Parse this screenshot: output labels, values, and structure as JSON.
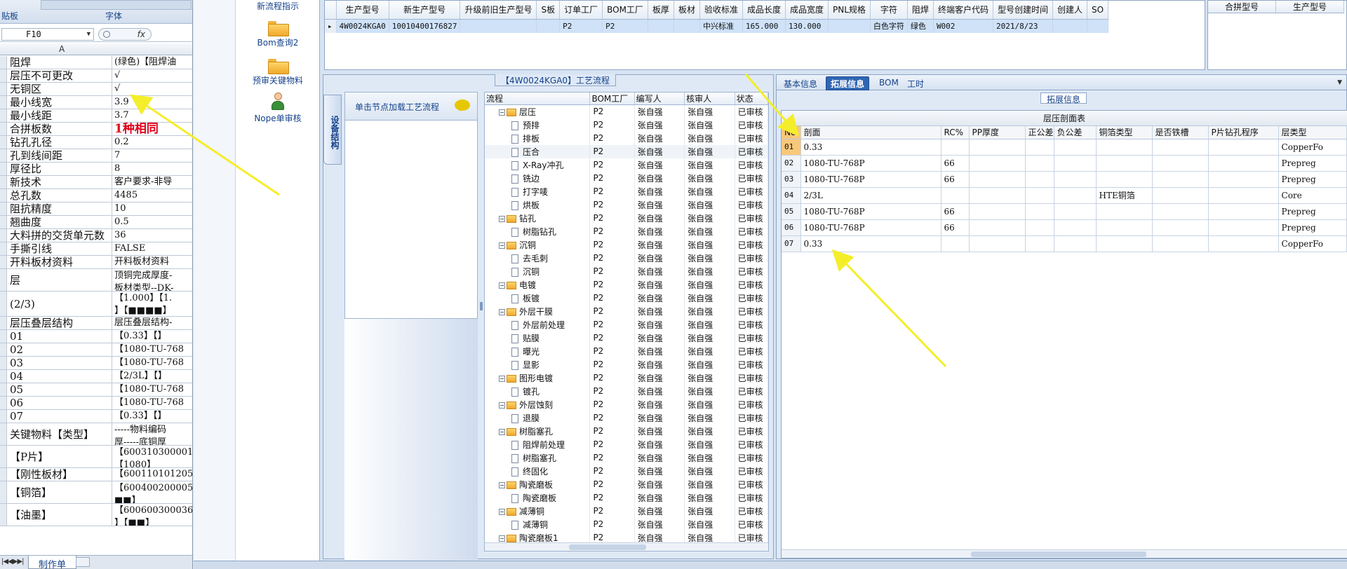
{
  "excel": {
    "ribbon_group_left": "贴板",
    "ribbon_group_font": "字体",
    "name_box": "F10",
    "fx": "fx",
    "col_header": "A",
    "rows": [
      {
        "a": "阻焊",
        "b": "(绿色)【阻焊油"
      },
      {
        "a": "层压不可更改",
        "b": "√"
      },
      {
        "a": "无铜区",
        "b": "√"
      },
      {
        "a": "最小线宽",
        "b": "3.9"
      },
      {
        "a": "最小线距",
        "b": "3.7"
      },
      {
        "a": "合拼板数",
        "b": "1种相同"
      },
      {
        "a": "钻孔孔径",
        "b": "0.2"
      },
      {
        "a": "孔到线间距",
        "b": "7"
      },
      {
        "a": "厚径比",
        "b": "8"
      },
      {
        "a": "新技术",
        "b": "客户要求-非导"
      },
      {
        "a": "总孔数",
        "b": "4485"
      },
      {
        "a": "阻抗精度",
        "b": "10"
      },
      {
        "a": "翘曲度",
        "b": "0.5"
      },
      {
        "a": "大料拼的交货单元数",
        "b": "36"
      },
      {
        "a": "手撕引线",
        "b": "FALSE"
      },
      {
        "a": "开料板材资料",
        "b": "开料板材资料"
      },
      {
        "a": "层",
        "b": "顶铜完成厚度-\n板材类型--DK-"
      },
      {
        "a": "(2/3)",
        "b": "【1.000】【1.\n】【■■■■】"
      },
      {
        "a": "层压叠层结构",
        "b": "层压叠层结构-"
      },
      {
        "a": "01",
        "b": "【0.33】【】"
      },
      {
        "a": "02",
        "b": "【1080-TU-768"
      },
      {
        "a": "03",
        "b": "【1080-TU-768"
      },
      {
        "a": "04",
        "b": "【2/3L】【】"
      },
      {
        "a": "05",
        "b": "【1080-TU-768"
      },
      {
        "a": "06",
        "b": "【1080-TU-768"
      },
      {
        "a": "07",
        "b": "【0.33】【】"
      },
      {
        "a": "关键物料【类型】",
        "b": "-----物料编码\n厚-----底铜厚"
      },
      {
        "a": "【P片】",
        "b": "【600310300001\n【1080】"
      },
      {
        "a": "【刚性板材】",
        "b": "【600110101205"
      },
      {
        "a": "【铜箔】",
        "b": "【600400200005\n■■】"
      },
      {
        "a": "【油墨】",
        "b": "【600600300036\n】【■■】"
      }
    ],
    "sheet_tab": "制作单"
  },
  "nav": {
    "items": [
      {
        "label": "新流程指示"
      },
      {
        "label": "Bom查询2"
      },
      {
        "label": "预审关键物料"
      },
      {
        "label": "Nope单审核"
      }
    ]
  },
  "top_grid": {
    "columns": [
      "生产型号",
      "新生产型号",
      "升级前旧生产型号",
      "S板",
      "订单工厂",
      "BOM工厂",
      "板厚",
      "板材",
      "验收标准",
      "成品长度",
      "成品宽度",
      "PNL规格",
      "字符",
      "阻焊",
      "终端客户代码",
      "型号创建时间",
      "创建人",
      "SO"
    ],
    "row": [
      "4W0024KGA0",
      "10010400176827",
      "",
      "",
      "P2",
      "P2",
      "",
      "",
      "中兴标准",
      "165.000",
      "130.000",
      "",
      "白色字符",
      "绿色",
      "W002",
      "2021/8/23",
      "",
      ""
    ]
  },
  "right_grid": {
    "columns": [
      "合拼型号",
      "生产型号"
    ]
  },
  "process": {
    "title": "【4W0024KGA0】工艺流程",
    "vertical_tab": "设备结构",
    "click_hint": "单击节点加载工艺流程",
    "columns": [
      "流程",
      "BOM工厂",
      "编写人",
      "核审人",
      "状态"
    ],
    "rows": [
      {
        "level": 0,
        "name": "层压",
        "bom": "P2",
        "writer": "张自强",
        "reviewer": "张自强",
        "status": "已审核"
      },
      {
        "level": 1,
        "name": "预排",
        "bom": "P2",
        "writer": "张自强",
        "reviewer": "张自强",
        "status": "已审核"
      },
      {
        "level": 1,
        "name": "排板",
        "bom": "P2",
        "writer": "张自强",
        "reviewer": "张自强",
        "status": "已审核"
      },
      {
        "level": 1,
        "name": "压合",
        "bom": "P2",
        "writer": "张自强",
        "reviewer": "张自强",
        "status": "已审核",
        "selected": true
      },
      {
        "level": 1,
        "name": "X-Ray冲孔",
        "bom": "P2",
        "writer": "张自强",
        "reviewer": "张自强",
        "status": "已审核"
      },
      {
        "level": 1,
        "name": "铣边",
        "bom": "P2",
        "writer": "张自强",
        "reviewer": "张自强",
        "status": "已审核"
      },
      {
        "level": 1,
        "name": "打字唛",
        "bom": "P2",
        "writer": "张自强",
        "reviewer": "张自强",
        "status": "已审核"
      },
      {
        "level": 1,
        "name": "烘板",
        "bom": "P2",
        "writer": "张自强",
        "reviewer": "张自强",
        "status": "已审核"
      },
      {
        "level": 0,
        "name": "钻孔",
        "bom": "P2",
        "writer": "张自强",
        "reviewer": "张自强",
        "status": "已审核"
      },
      {
        "level": 1,
        "name": "树脂钻孔",
        "bom": "P2",
        "writer": "张自强",
        "reviewer": "张自强",
        "status": "已审核"
      },
      {
        "level": 0,
        "name": "沉铜",
        "bom": "P2",
        "writer": "张自强",
        "reviewer": "张自强",
        "status": "已审核"
      },
      {
        "level": 1,
        "name": "去毛刺",
        "bom": "P2",
        "writer": "张自强",
        "reviewer": "张自强",
        "status": "已审核"
      },
      {
        "level": 1,
        "name": "沉铜",
        "bom": "P2",
        "writer": "张自强",
        "reviewer": "张自强",
        "status": "已审核"
      },
      {
        "level": 0,
        "name": "电镀",
        "bom": "P2",
        "writer": "张自强",
        "reviewer": "张自强",
        "status": "已审核"
      },
      {
        "level": 1,
        "name": "板镀",
        "bom": "P2",
        "writer": "张自强",
        "reviewer": "张自强",
        "status": "已审核"
      },
      {
        "level": 0,
        "name": "外层干膜",
        "bom": "P2",
        "writer": "张自强",
        "reviewer": "张自强",
        "status": "已审核"
      },
      {
        "level": 1,
        "name": "外层前处理",
        "bom": "P2",
        "writer": "张自强",
        "reviewer": "张自强",
        "status": "已审核"
      },
      {
        "level": 1,
        "name": "贴膜",
        "bom": "P2",
        "writer": "张自强",
        "reviewer": "张自强",
        "status": "已审核"
      },
      {
        "level": 1,
        "name": "曝光",
        "bom": "P2",
        "writer": "张自强",
        "reviewer": "张自强",
        "status": "已审核"
      },
      {
        "level": 1,
        "name": "显影",
        "bom": "P2",
        "writer": "张自强",
        "reviewer": "张自强",
        "status": "已审核"
      },
      {
        "level": 0,
        "name": "图形电镀",
        "bom": "P2",
        "writer": "张自强",
        "reviewer": "张自强",
        "status": "已审核"
      },
      {
        "level": 1,
        "name": "镀孔",
        "bom": "P2",
        "writer": "张自强",
        "reviewer": "张自强",
        "status": "已审核"
      },
      {
        "level": 0,
        "name": "外层蚀刻",
        "bom": "P2",
        "writer": "张自强",
        "reviewer": "张自强",
        "status": "已审核"
      },
      {
        "level": 1,
        "name": "退膜",
        "bom": "P2",
        "writer": "张自强",
        "reviewer": "张自强",
        "status": "已审核"
      },
      {
        "level": 0,
        "name": "树脂塞孔",
        "bom": "P2",
        "writer": "张自强",
        "reviewer": "张自强",
        "status": "已审核"
      },
      {
        "level": 1,
        "name": "阻焊前处理",
        "bom": "P2",
        "writer": "张自强",
        "reviewer": "张自强",
        "status": "已审核"
      },
      {
        "level": 1,
        "name": "树脂塞孔",
        "bom": "P2",
        "writer": "张自强",
        "reviewer": "张自强",
        "status": "已审核"
      },
      {
        "level": 1,
        "name": "终固化",
        "bom": "P2",
        "writer": "张自强",
        "reviewer": "张自强",
        "status": "已审核"
      },
      {
        "level": 0,
        "name": "陶瓷磨板",
        "bom": "P2",
        "writer": "张自强",
        "reviewer": "张自强",
        "status": "已审核"
      },
      {
        "level": 1,
        "name": "陶瓷磨板",
        "bom": "P2",
        "writer": "张自强",
        "reviewer": "张自强",
        "status": "已审核"
      },
      {
        "level": 0,
        "name": "减薄铜",
        "bom": "P2",
        "writer": "张自强",
        "reviewer": "张自强",
        "status": "已审核"
      },
      {
        "level": 1,
        "name": "减薄铜",
        "bom": "P2",
        "writer": "张自强",
        "reviewer": "张自强",
        "status": "已审核"
      },
      {
        "level": 0,
        "name": "陶瓷磨板1",
        "bom": "P2",
        "writer": "张自强",
        "reviewer": "张自强",
        "status": "已审核"
      }
    ]
  },
  "right_panel": {
    "tabs": [
      "基本信息",
      "拓展信息",
      "BOM",
      "工时"
    ],
    "active_tab": 1,
    "group_label": "拓展信息",
    "table_title": "层压剖面表",
    "columns": [
      "No",
      "剖面",
      "RC%",
      "PP厚度",
      "正公差",
      "负公差",
      "铜箔类型",
      "是否铁槽",
      "P片钻孔程序",
      "层类型"
    ],
    "rows": [
      [
        "01",
        "0.33",
        "",
        "",
        "",
        "",
        "",
        "",
        "",
        "CopperFo"
      ],
      [
        "02",
        "1080-TU-768P",
        "66",
        "",
        "",
        "",
        "",
        "",
        "",
        "Prepreg"
      ],
      [
        "03",
        "1080-TU-768P",
        "66",
        "",
        "",
        "",
        "",
        "",
        "",
        "Prepreg"
      ],
      [
        "04",
        "2/3L",
        "",
        "",
        "",
        "",
        "HTE铜箔",
        "",
        "",
        "Core"
      ],
      [
        "05",
        "1080-TU-768P",
        "66",
        "",
        "",
        "",
        "",
        "",
        "",
        "Prepreg"
      ],
      [
        "06",
        "1080-TU-768P",
        "66",
        "",
        "",
        "",
        "",
        "",
        "",
        "Prepreg"
      ],
      [
        "07",
        "0.33",
        "",
        "",
        "",
        "",
        "",
        "",
        "",
        "CopperFo"
      ]
    ]
  },
  "colors": {
    "arrow": "#f4ee2a",
    "highlight_red": "#e0001a",
    "selected_row": "#cfe2f8",
    "active_tab": "#2f66b3"
  }
}
